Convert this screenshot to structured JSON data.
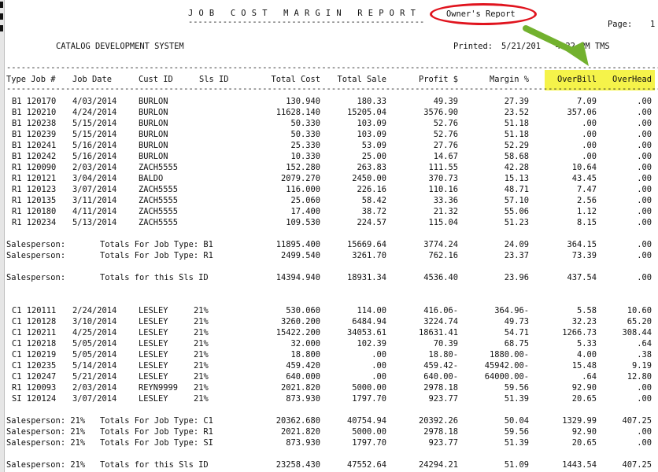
{
  "report": {
    "title": "JOB COST MARGIN REPORT",
    "owner_label": "Owner's Report",
    "page_label": "Page:",
    "page_number": "1",
    "system_name": "CATALOG DEVELOPMENT SYSTEM",
    "printed_label": "Printed:",
    "printed_value": "5/21/201   4:22 PM TMS"
  },
  "columns": [
    "Type Job #",
    "Job Date",
    "Cust ID",
    "Sls ID",
    "Total Cost",
    "Total Sale",
    "Profit $",
    "Margin %",
    "OverBill",
    "OverHead"
  ],
  "section1_rows": [
    [
      "B1 120170",
      "4/03/2014",
      "BURLON",
      "",
      "130.940",
      "180.33",
      "49.39",
      "27.39",
      "7.09",
      ".00"
    ],
    [
      "B1 120210",
      "4/24/2014",
      "BURLON",
      "",
      "11628.140",
      "15205.04",
      "3576.90",
      "23.52",
      "357.06",
      ".00"
    ],
    [
      "B1 120238",
      "5/15/2014",
      "BURLON",
      "",
      "50.330",
      "103.09",
      "52.76",
      "51.18",
      ".00",
      ".00"
    ],
    [
      "B1 120239",
      "5/15/2014",
      "BURLON",
      "",
      "50.330",
      "103.09",
      "52.76",
      "51.18",
      ".00",
      ".00"
    ],
    [
      "B1 120241",
      "5/16/2014",
      "BURLON",
      "",
      "25.330",
      "53.09",
      "27.76",
      "52.29",
      ".00",
      ".00"
    ],
    [
      "B1 120242",
      "5/16/2014",
      "BURLON",
      "",
      "10.330",
      "25.00",
      "14.67",
      "58.68",
      ".00",
      ".00"
    ],
    [
      "R1 120090",
      "2/03/2014",
      "ZACH5555",
      "",
      "152.280",
      "263.83",
      "111.55",
      "42.28",
      "10.64",
      ".00"
    ],
    [
      "R1 120121",
      "3/04/2014",
      "BALDO",
      "",
      "2079.270",
      "2450.00",
      "370.73",
      "15.13",
      "43.45",
      ".00"
    ],
    [
      "R1 120123",
      "3/07/2014",
      "ZACH5555",
      "",
      "116.000",
      "226.16",
      "110.16",
      "48.71",
      "7.47",
      ".00"
    ],
    [
      "R1 120135",
      "3/11/2014",
      "ZACH5555",
      "",
      "25.060",
      "58.42",
      "33.36",
      "57.10",
      "2.56",
      ".00"
    ],
    [
      "R1 120180",
      "4/11/2014",
      "ZACH5555",
      "",
      "17.400",
      "38.72",
      "21.32",
      "55.06",
      "1.12",
      ".00"
    ],
    [
      "R1 120234",
      "5/13/2014",
      "ZACH5555",
      "",
      "109.530",
      "224.57",
      "115.04",
      "51.23",
      "8.15",
      ".00"
    ]
  ],
  "section1_totals": [
    [
      "Salesperson:",
      "Totals For Job Type: B1",
      "11895.400",
      "15669.64",
      "3774.24",
      "24.09",
      "364.15",
      ".00"
    ],
    [
      "Salesperson:",
      "Totals For Job Type: R1",
      "2499.540",
      "3261.70",
      "762.16",
      "23.37",
      "73.39",
      ".00"
    ]
  ],
  "section1_grand": [
    "Salesperson:",
    "Totals for this Sls ID",
    "14394.940",
    "18931.34",
    "4536.40",
    "23.96",
    "437.54",
    ".00"
  ],
  "section2_rows": [
    [
      "C1 120111",
      "2/24/2014",
      "LESLEY",
      "21%",
      "530.060",
      "114.00",
      "416.06-",
      "364.96-",
      "5.58",
      "10.60"
    ],
    [
      "C1 120128",
      "3/10/2014",
      "LESLEY",
      "21%",
      "3260.200",
      "6484.94",
      "3224.74",
      "49.73",
      "32.23",
      "65.20"
    ],
    [
      "C1 120211",
      "4/25/2014",
      "LESLEY",
      "21%",
      "15422.200",
      "34053.61",
      "18631.41",
      "54.71",
      "1266.73",
      "308.44"
    ],
    [
      "C1 120218",
      "5/05/2014",
      "LESLEY",
      "21%",
      "32.000",
      "102.39",
      "70.39",
      "68.75",
      "5.33",
      ".64"
    ],
    [
      "C1 120219",
      "5/05/2014",
      "LESLEY",
      "21%",
      "18.800",
      ".00",
      "18.80-",
      "1880.00-",
      "4.00",
      ".38"
    ],
    [
      "C1 120235",
      "5/14/2014",
      "LESLEY",
      "21%",
      "459.420",
      ".00",
      "459.42-",
      "45942.00-",
      "15.48",
      "9.19"
    ],
    [
      "C1 120247",
      "5/21/2014",
      "LESLEY",
      "21%",
      "640.000",
      ".00",
      "640.00-",
      "64000.00-",
      ".64",
      "12.80"
    ],
    [
      "R1 120093",
      "2/03/2014",
      "REYN9999",
      "21%",
      "2021.820",
      "5000.00",
      "2978.18",
      "59.56",
      "92.90",
      ".00"
    ],
    [
      "SI 120124",
      "3/07/2014",
      "LESLEY",
      "21%",
      "873.930",
      "1797.70",
      "923.77",
      "51.39",
      "20.65",
      ".00"
    ]
  ],
  "section2_totals": [
    [
      "Salesperson: 21%",
      "Totals For Job Type: C1",
      "20362.680",
      "40754.94",
      "20392.26",
      "50.04",
      "1329.99",
      "407.25"
    ],
    [
      "Salesperson: 21%",
      "Totals For Job Type: R1",
      "2021.820",
      "5000.00",
      "2978.18",
      "59.56",
      "92.90",
      ".00"
    ],
    [
      "Salesperson: 21%",
      "Totals For Job Type: SI",
      "873.930",
      "1797.70",
      "923.77",
      "51.39",
      "20.65",
      ".00"
    ]
  ],
  "section2_grand": [
    "Salesperson: 21%",
    "Totals for this Sls ID",
    "23258.430",
    "47552.64",
    "24294.21",
    "51.09",
    "1443.54",
    "407.25"
  ],
  "colors": {
    "highlight": "#f5f34a",
    "circle": "#e0141e",
    "arrow": "#72b12e"
  },
  "icons": {
    "annotation_circle": "red-oval-annotation",
    "annotation_arrow": "green-arrow-annotation"
  }
}
